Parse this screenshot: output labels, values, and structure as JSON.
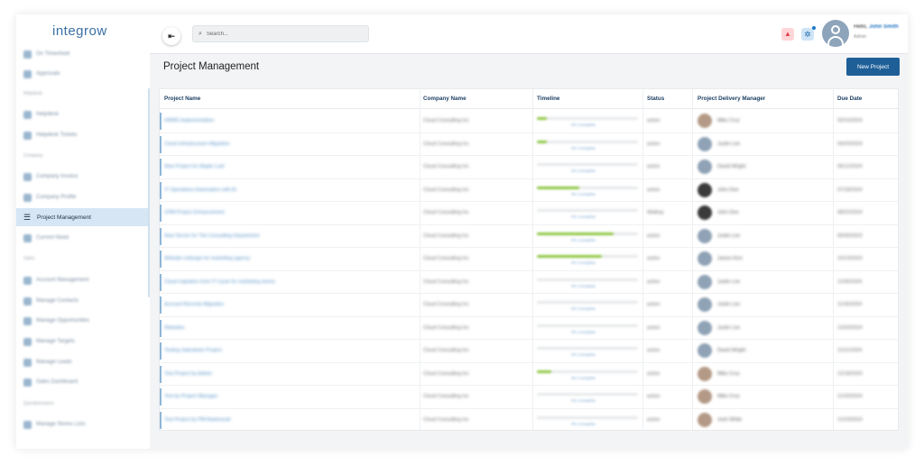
{
  "app": {
    "logo_text": "integrow"
  },
  "sidebar": {
    "items": [
      {
        "label": "On Timesheet",
        "top": 0
      },
      {
        "label": "Approvals"
      },
      {
        "label": "Helpdesk"
      },
      {
        "label": "Helpdesk Tickets"
      },
      {
        "label": "Company Invoice"
      },
      {
        "label": "Company Profile"
      },
      {
        "label": "Project Management"
      },
      {
        "label": "Current Need"
      },
      {
        "label": "Account Management"
      },
      {
        "label": "Manage Contacts"
      },
      {
        "label": "Manage Opportunities"
      },
      {
        "label": "Manage Targets"
      },
      {
        "label": "Manage Leads"
      },
      {
        "label": "Sales Dashboard"
      },
      {
        "label": "Manage Stores Lists"
      }
    ],
    "headings": [
      "Helpdesk",
      "Company",
      "Sales",
      "Questionnaires"
    ],
    "active_label": "Project Management"
  },
  "topbar": {
    "search_placeholder": "Search...",
    "greeting": "Hello,",
    "user_name": "John Smith",
    "user_role": "Admin"
  },
  "page": {
    "title": "Project Management",
    "new_button": "New Project"
  },
  "table": {
    "headers": [
      "Project Name",
      "Company Name",
      "Timeline",
      "Status",
      "Project Delivery Manager",
      "Due Date"
    ],
    "rows": [
      {
        "project": "HRMS Implementation",
        "company": "Cloud Consulting Inc",
        "progress": 0.1,
        "timeline": "0% Complete",
        "status": "active",
        "manager": "Mike Cruz",
        "avatar": "photo2",
        "due": "03/15/2024"
      },
      {
        "project": "Cloud Infrastructure Migration",
        "company": "Cloud Consulting Inc",
        "progress": 0.1,
        "timeline": "0% Complete",
        "status": "active",
        "manager": "Justin Lee",
        "avatar": "gray",
        "due": "04/20/2024"
      },
      {
        "project": "New Project for Maple Leaf",
        "company": "Cloud Consulting Inc",
        "progress": 0.0,
        "timeline": "0% Complete",
        "status": "active",
        "manager": "David Wright",
        "avatar": "gray",
        "due": "06/12/2024"
      },
      {
        "project": "IT Operations Automation with AI",
        "company": "Cloud Consulting Inc",
        "progress": 0.42,
        "timeline": "0% Complete",
        "status": "active",
        "manager": "John Doe",
        "avatar": "photo3",
        "due": "07/18/2024"
      },
      {
        "project": "CRM Project Enhancement",
        "company": "Cloud Consulting Inc",
        "progress": 0.0,
        "timeline": "0% Complete",
        "status": "Waiting",
        "manager": "John Doe",
        "avatar": "photo3",
        "due": "08/22/2024"
      },
      {
        "project": "New Server for The Consulting Department",
        "company": "Cloud Consulting Inc",
        "progress": 0.76,
        "timeline": "0% Complete",
        "status": "active",
        "manager": "Justin Lee",
        "avatar": "gray",
        "due": "09/30/2024"
      },
      {
        "project": "Website redesign for marketing agency",
        "company": "Cloud Consulting Inc",
        "progress": 0.64,
        "timeline": "0% Complete",
        "status": "active",
        "manager": "James Kerr",
        "avatar": "gray",
        "due": "10/14/2024"
      },
      {
        "project": "Cloud migration from IT Cycle for marketing stores",
        "company": "Cloud Consulting Inc",
        "progress": 0.0,
        "timeline": "0% Complete",
        "status": "active",
        "manager": "Justin Lee",
        "avatar": "gray",
        "due": "11/05/2024"
      },
      {
        "project": "Account Records Migration",
        "company": "Cloud Consulting Inc",
        "progress": 0.0,
        "timeline": "0% Complete",
        "status": "active",
        "manager": "Justin Lee",
        "avatar": "gray",
        "due": "11/26/2024"
      },
      {
        "project": "Websites",
        "company": "Cloud Consulting Inc",
        "progress": 0.0,
        "timeline": "0% Complete",
        "status": "active",
        "manager": "Justin Lee",
        "avatar": "gray",
        "due": "12/03/2024"
      },
      {
        "project": "Testing Salesteam Project",
        "company": "Cloud Consulting Inc",
        "progress": 0.0,
        "timeline": "0% Complete",
        "status": "active",
        "manager": "David Wright",
        "avatar": "gray",
        "due": "12/11/2024"
      },
      {
        "project": "Test Project by Admin",
        "company": "Cloud Consulting Inc",
        "progress": 0.14,
        "timeline": "0% Complete",
        "status": "active",
        "manager": "Mike Cruz",
        "avatar": "photo2",
        "due": "12/18/2024"
      },
      {
        "project": "Test by Project Manager",
        "company": "Cloud Consulting Inc",
        "progress": 0.0,
        "timeline": "0% Complete",
        "status": "active",
        "manager": "Mike Cruz",
        "avatar": "photo2",
        "due": "12/20/2024"
      },
      {
        "project": "Test Project by PM Balamurali",
        "company": "Cloud Consulting Inc",
        "progress": 0.0,
        "timeline": "0% Complete",
        "status": "active",
        "manager": "Josh White",
        "avatar": "photo2",
        "due": "12/23/2024"
      }
    ]
  }
}
